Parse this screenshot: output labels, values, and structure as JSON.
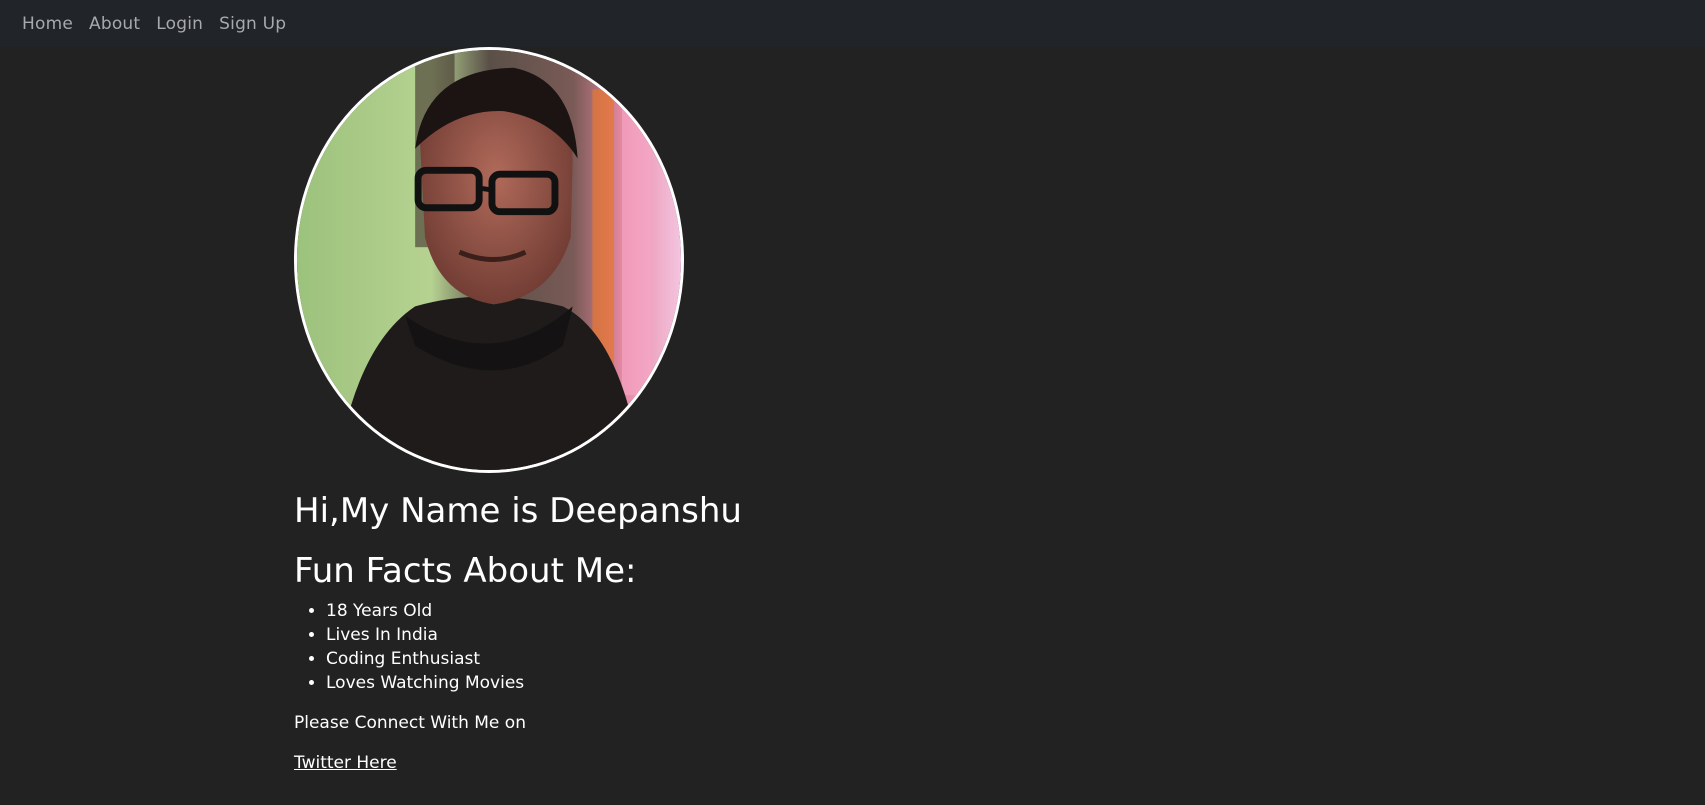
{
  "nav": {
    "items": [
      {
        "label": "Home"
      },
      {
        "label": "About"
      },
      {
        "label": "Login"
      },
      {
        "label": "Sign Up"
      }
    ]
  },
  "profile": {
    "photo_icon": "profile-photo",
    "name_heading": "Hi,My Name is Deepanshu",
    "facts_heading": "Fun Facts About Me:",
    "facts": [
      "18 Years Old",
      "Lives In India",
      "Coding Enthusiast",
      "Loves Watching Movies"
    ],
    "connect_text": "Please Connect With Me on",
    "twitter_link": "Twitter Here"
  },
  "colors": {
    "background": "#222222",
    "navbar": "#212529",
    "nav_text": "#a7a9ac",
    "text": "#ffffff"
  }
}
